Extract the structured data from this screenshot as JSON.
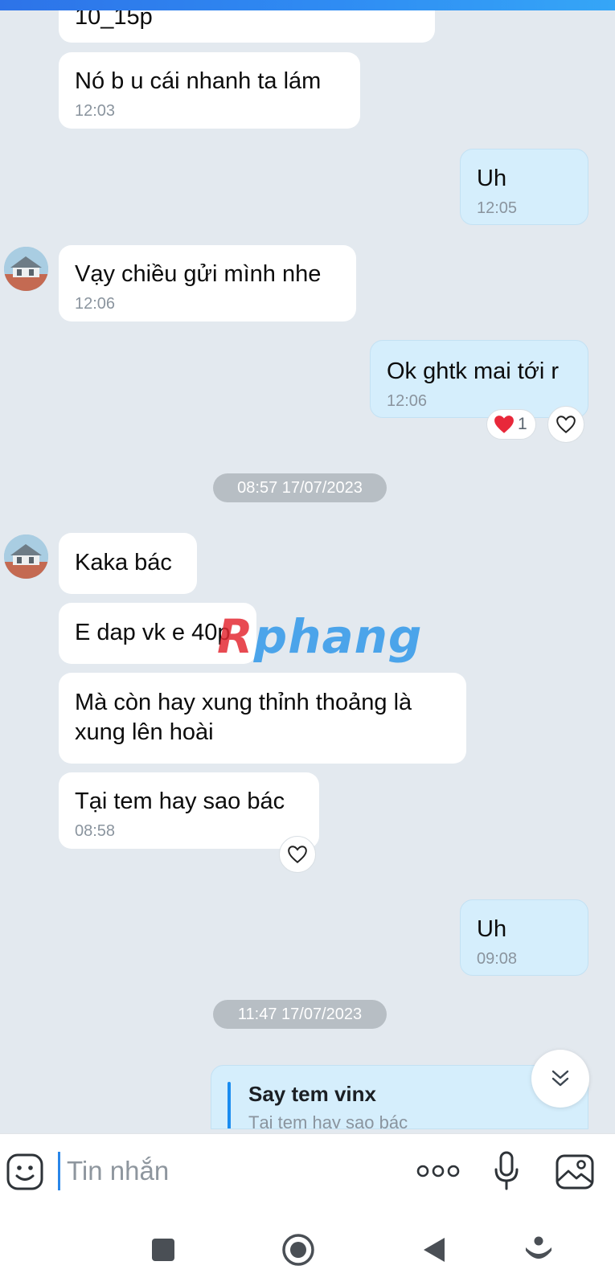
{
  "messages": {
    "m0": {
      "text": "10_15p"
    },
    "m1": {
      "text": "Nó b u cái nhanh ta lám",
      "time": "12:03"
    },
    "m2": {
      "text": "Uh",
      "time": "12:05"
    },
    "m3": {
      "text": "Vạy chiều gửi mình nhe",
      "time": "12:06"
    },
    "m4": {
      "text": "Ok ghtk mai tới r",
      "time": "12:06",
      "reaction_count": "1"
    },
    "d1": "08:57 17/07/2023",
    "m5": {
      "text": "Kaka bác"
    },
    "m6": {
      "text": "E dap vk e 40p"
    },
    "m7": {
      "text": "Mà còn hay xung thỉnh thoảng là xung lên hoài"
    },
    "m8": {
      "text": "Tại tem hay sao bác",
      "time": "08:58"
    },
    "m9": {
      "text": "Uh",
      "time": "09:08"
    },
    "d2": "11:47 17/07/2023",
    "reply": {
      "title": "Say tem vinx",
      "quoted": "Tại tem hay sao bác"
    }
  },
  "watermark": {
    "r": "R",
    "rest": "phang"
  },
  "composer": {
    "placeholder": "Tin nhắn"
  },
  "icons": {
    "emoji": "emoji-icon",
    "more": "more-options-icon",
    "mic": "microphone-icon",
    "image": "image-icon",
    "heart_filled": "heart-filled-icon",
    "heart_outline": "heart-outline-icon",
    "scroll_down": "double-chevron-down-icon"
  },
  "colors": {
    "accent": "#2a86e8",
    "incoming_bubble": "#ffffff",
    "outgoing_bubble": "#d5eefc",
    "chat_background": "#e3e9ef",
    "date_pill": "#b7bec4",
    "heart": "#e8283a"
  }
}
